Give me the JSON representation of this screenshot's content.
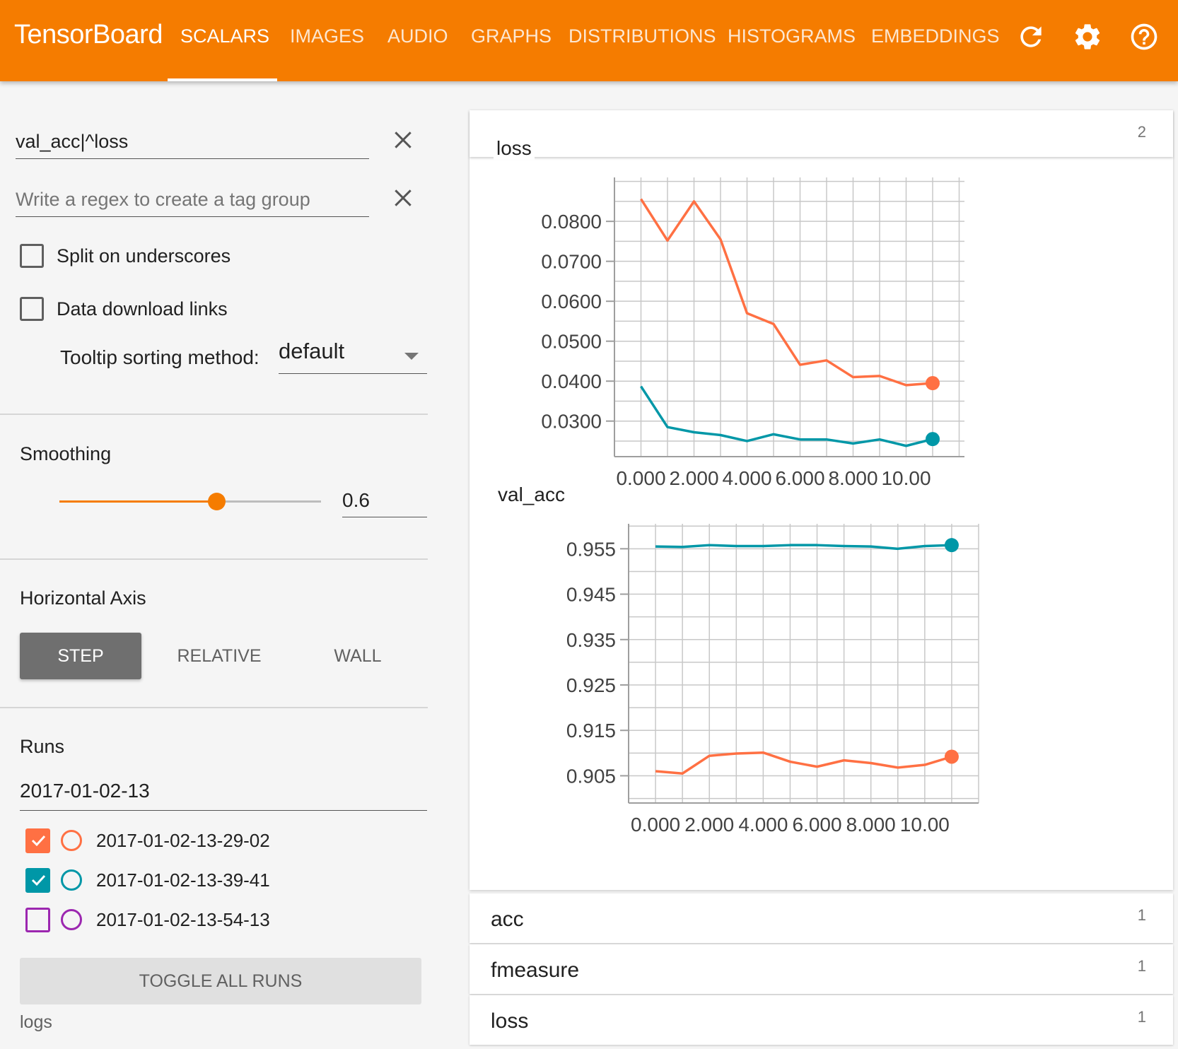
{
  "app": {
    "brand": "TensorBoard"
  },
  "tabs": [
    {
      "label": "SCALARS",
      "active": true
    },
    {
      "label": "IMAGES"
    },
    {
      "label": "AUDIO"
    },
    {
      "label": "GRAPHS"
    },
    {
      "label": "DISTRIBUTIONS"
    },
    {
      "label": "HISTOGRAMS"
    },
    {
      "label": "EMBEDDINGS"
    }
  ],
  "toolbar_icons": [
    "refresh-icon",
    "settings-icon",
    "help-icon"
  ],
  "sidebar": {
    "tag_regex": {
      "value": "val_acc|^loss"
    },
    "tag_group": {
      "placeholder": "Write a regex to create a tag group"
    },
    "split_underscores": {
      "label": "Split on underscores",
      "checked": false
    },
    "download_links": {
      "label": "Data download links",
      "checked": false
    },
    "tooltip_sorting": {
      "label": "Tooltip sorting method:",
      "value": "default"
    },
    "smoothing": {
      "title": "Smoothing",
      "value": "0.6",
      "fraction": 0.6
    },
    "horizontal_axis": {
      "title": "Horizontal Axis",
      "options": [
        "STEP",
        "RELATIVE",
        "WALL"
      ],
      "selected": "STEP"
    },
    "runs": {
      "title": "Runs",
      "filter": "2017-01-02-13",
      "items": [
        {
          "label": "2017-01-02-13-29-02",
          "checked": true,
          "color": "#ff7043"
        },
        {
          "label": "2017-01-02-13-39-41",
          "checked": true,
          "color": "#0097a7"
        },
        {
          "label": "2017-01-02-13-54-13",
          "checked": false,
          "color": "#9c27b0"
        }
      ]
    },
    "toggle_all": "TOGGLE ALL RUNS",
    "logdir": "logs"
  },
  "main": {
    "expanded_group": {
      "title": "loss",
      "count": "2"
    },
    "groups": [
      {
        "label": "acc",
        "count": "1"
      },
      {
        "label": "fmeasure",
        "count": "1"
      },
      {
        "label": "loss",
        "count": "1"
      }
    ]
  },
  "chart_data": [
    {
      "type": "line",
      "title": "",
      "xlabel": "",
      "ylabel": "",
      "x": [
        0,
        1,
        2,
        3,
        4,
        5,
        6,
        7,
        8,
        9,
        10,
        11
      ],
      "xticks": [
        "0.000",
        "2.000",
        "4.000",
        "6.000",
        "8.000",
        "10.00"
      ],
      "xtick_values": [
        0,
        2,
        4,
        6,
        8,
        10
      ],
      "yticks": [
        "0.0800",
        "0.0700",
        "0.0600",
        "0.0500",
        "0.0400",
        "0.0300"
      ],
      "ytick_values": [
        0.08,
        0.07,
        0.06,
        0.05,
        0.04,
        0.03
      ],
      "xlim": [
        -1.0,
        12.2
      ],
      "ylim": [
        0.0211,
        0.091
      ],
      "grid": true,
      "series": [
        {
          "color": "#ff7043",
          "values": [
            0.0856,
            0.0752,
            0.085,
            0.0755,
            0.057,
            0.0543,
            0.0441,
            0.0452,
            0.041,
            0.0413,
            0.039,
            0.0395
          ]
        },
        {
          "color": "#0097a7",
          "values": [
            0.0387,
            0.0285,
            0.0272,
            0.0265,
            0.025,
            0.0267,
            0.0254,
            0.0254,
            0.0244,
            0.0254,
            0.0238,
            0.0255
          ]
        }
      ]
    },
    {
      "type": "line",
      "title": "val_acc",
      "xlabel": "",
      "ylabel": "",
      "x": [
        0,
        1,
        2,
        3,
        4,
        5,
        6,
        7,
        8,
        9,
        10,
        11
      ],
      "xticks": [
        "0.000",
        "2.000",
        "4.000",
        "6.000",
        "8.000",
        "10.00"
      ],
      "xtick_values": [
        0,
        2,
        4,
        6,
        8,
        10
      ],
      "yticks": [
        "0.955",
        "0.945",
        "0.935",
        "0.925",
        "0.915",
        "0.905"
      ],
      "ytick_values": [
        0.955,
        0.945,
        0.935,
        0.925,
        0.915,
        0.905
      ],
      "xlim": [
        -1.0,
        12.0
      ],
      "ylim": [
        0.899,
        0.9605
      ],
      "grid": true,
      "series": [
        {
          "color": "#0097a7",
          "values": [
            0.9555,
            0.9554,
            0.9558,
            0.9556,
            0.9556,
            0.9558,
            0.9558,
            0.9556,
            0.9555,
            0.955,
            0.9556,
            0.9558
          ]
        },
        {
          "color": "#ff7043",
          "values": [
            0.906,
            0.9055,
            0.9094,
            0.9099,
            0.9101,
            0.9081,
            0.907,
            0.9084,
            0.9078,
            0.9068,
            0.9074,
            0.9092
          ]
        }
      ]
    }
  ]
}
